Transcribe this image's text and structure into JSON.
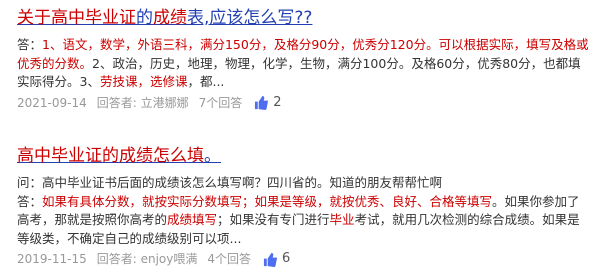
{
  "results": [
    {
      "title_hl_a": "关于",
      "title_hl_b": "高中毕业证",
      "title_rest_a": "的",
      "title_hl_c": "成绩",
      "title_rest_b": "表,应该怎么写??",
      "abstract": {
        "p1": "答：",
        "h1": "1、语文，数学，外语三科，满分150分，及格分90分，优秀分120分。可以根据实际，填写及格或优秀的分数。",
        "p2": "2、政治，历史，地理，物理，化学，生物，满分100分。及格60分，优秀80分，也都填实际得分。3、",
        "h2": "劳技课，选修课",
        "p3": "，都..."
      },
      "date": "2021-09-14",
      "answerer": "回答者: 立港娜娜",
      "answers": "7个回答",
      "likes": "2"
    },
    {
      "title_hl": "高中毕业证的成绩怎么填",
      "title_rest": "。",
      "question": "问：高中毕业证书后面的成绩该怎么填写啊？四川省的。知道的朋友帮帮忙啊",
      "abstract": {
        "p1": "答：",
        "h1": "如果有具体分数，就按实际分数填写；如果是等级，就按优秀、良好、合格等填写",
        "p2": "。如果你参加了高考，那就是按照你高考的",
        "h2": "成绩填写",
        "p3": "；如果没有专门进行",
        "h3": "毕业",
        "p4": "考试，就用几次检测的综合成绩。如果是等级类，不确定自己的成绩级别可以项..."
      },
      "date": "2019-11-15",
      "answerer": "回答者: enjoy喂满",
      "answers": "4个回答",
      "likes": "6"
    }
  ],
  "colors": {
    "link": "#2440b3",
    "highlight": "#cc0000",
    "meta": "#999999",
    "like_icon": "#4e6ef2"
  },
  "icons": {
    "like": "thumbs-up-icon"
  }
}
